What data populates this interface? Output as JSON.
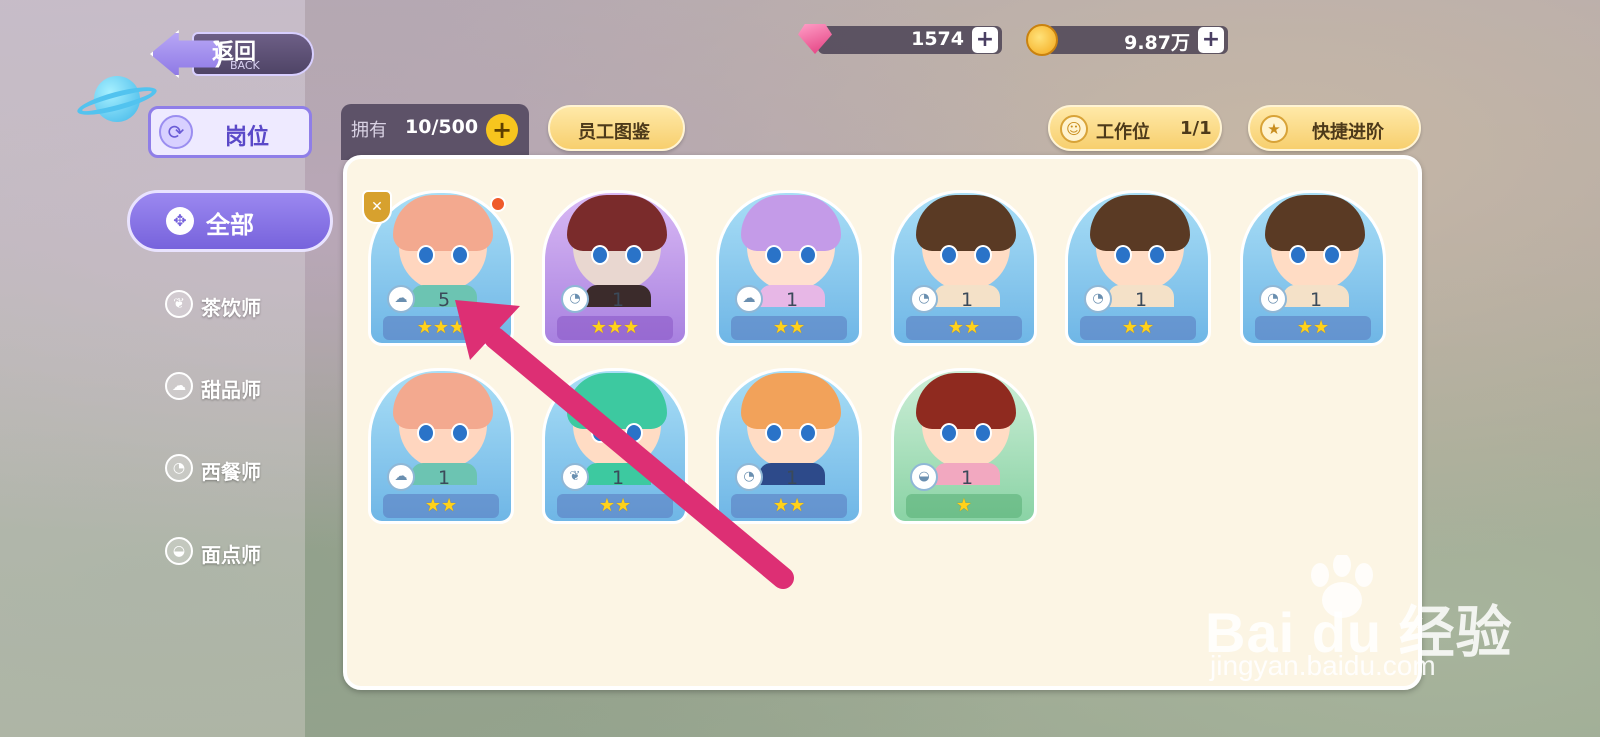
{
  "header": {
    "back_label_cn": "返回",
    "back_label_en": "BACK",
    "gems": "1574",
    "coins": "9.87万"
  },
  "sidebar": {
    "position_tab": "岗位",
    "all_label": "全部",
    "items": [
      {
        "label": "茶饮师",
        "icon": "leaf-icon"
      },
      {
        "label": "甜品师",
        "icon": "cupcake-icon"
      },
      {
        "label": "西餐师",
        "icon": "steak-icon"
      },
      {
        "label": "面点师",
        "icon": "dumpling-icon"
      }
    ]
  },
  "toolbar": {
    "owned_label": "拥有",
    "owned_value": "10/500",
    "catalog_label": "员工图鉴",
    "workstation_label": "工作位",
    "workstation_value": "1/1",
    "quick_advance_label": "快捷进阶"
  },
  "cards": [
    {
      "level": "5",
      "stars": "★★★",
      "theme": "blue",
      "role": "cupcake-icon",
      "hair": "#f3a98f",
      "skin": "#ffd6bf",
      "shirt": "#6cc4b2"
    },
    {
      "level": "1",
      "stars": "★★★",
      "theme": "purple",
      "role": "steak-icon",
      "hair": "#7a2b2b",
      "skin": "#e9d7d0",
      "shirt": "#3b2b2b"
    },
    {
      "level": "1",
      "stars": "★★",
      "theme": "blue",
      "role": "cupcake-icon",
      "hair": "#c49be8",
      "skin": "#ffe0cf",
      "shirt": "#e7b7e6"
    },
    {
      "level": "1",
      "stars": "★★",
      "theme": "blue",
      "role": "steak-icon",
      "hair": "#5a3a24",
      "skin": "#ffdcc4",
      "shirt": "#f4e1c8"
    },
    {
      "level": "1",
      "stars": "★★",
      "theme": "blue",
      "role": "steak-icon",
      "hair": "#5a3a24",
      "skin": "#ffdcc4",
      "shirt": "#f4e1c8"
    },
    {
      "level": "1",
      "stars": "★★",
      "theme": "blue",
      "role": "steak-icon",
      "hair": "#5a3a24",
      "skin": "#ffdcc4",
      "shirt": "#f4e1c8"
    },
    {
      "level": "1",
      "stars": "★★",
      "theme": "blue",
      "role": "cupcake-icon",
      "hair": "#f3a98f",
      "skin": "#ffd6bf",
      "shirt": "#6cc4b2"
    },
    {
      "level": "1",
      "stars": "★★",
      "theme": "blue",
      "role": "leaf-icon",
      "hair": "#3dc9a0",
      "skin": "#ffdcc4",
      "shirt": "#3dc9a0"
    },
    {
      "level": "1",
      "stars": "★★",
      "theme": "blue",
      "role": "steak-icon",
      "hair": "#f2a25a",
      "skin": "#ffdcc4",
      "shirt": "#2d4a8a"
    },
    {
      "level": "1",
      "stars": "★",
      "theme": "green",
      "role": "dumpling-icon",
      "hair": "#8f2a1f",
      "skin": "#ffdcc4",
      "shirt": "#f2a8c0"
    }
  ],
  "watermark": {
    "brand": "Bai du 经验",
    "url": "jingyan.baidu.com"
  },
  "colors": {
    "accent_purple": "#7763dc",
    "gold": "#f7c51e",
    "arrow_pink": "#dd2f74"
  }
}
